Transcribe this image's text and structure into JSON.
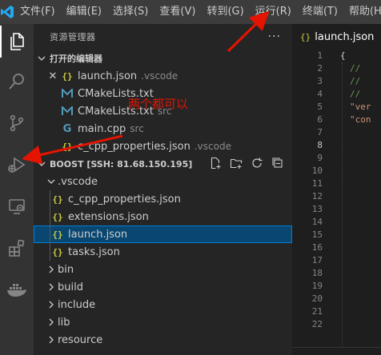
{
  "menu": [
    "文件(F)",
    "编辑(E)",
    "选择(S)",
    "查看(V)",
    "转到(G)",
    "运行(R)",
    "终端(T)",
    "帮助(H)"
  ],
  "sidebar": {
    "title": "资源管理器",
    "open_editors": {
      "header": "打开的编辑器",
      "items": [
        {
          "label": "launch.json",
          "desc": ".vscode",
          "icon": "json-icon"
        },
        {
          "label": "CMakeLists.txt",
          "desc": "",
          "icon": "cmake-icon"
        },
        {
          "label": "CMakeLists.txt",
          "desc": "src",
          "icon": "cmake-icon"
        },
        {
          "label": "main.cpp",
          "desc": "src",
          "icon": "cpp-icon"
        },
        {
          "label": "c_cpp_properties.json",
          "desc": ".vscode",
          "icon": "json-icon"
        }
      ]
    },
    "workspace": {
      "header": "BOOST [SSH: 81.68.150.195]",
      "vscode_folder": ".vscode",
      "vscode_files": [
        "c_cpp_properties.json",
        "extensions.json",
        "launch.json",
        "tasks.json"
      ],
      "folders": [
        "bin",
        "build",
        "include",
        "lib",
        "resource"
      ]
    }
  },
  "editor": {
    "tab_label": "launch.json",
    "line_numbers": [
      "1",
      "2",
      "3",
      "4",
      "5",
      "6",
      "7",
      "8",
      "9",
      "10",
      "11",
      "12",
      "13",
      "14",
      "15",
      "16",
      "17",
      "18",
      "19",
      "20",
      "21",
      "22"
    ],
    "code": {
      "l1": "{",
      "l2": "// ",
      "l3": "// ",
      "l4": "// ",
      "l5": "\"ver",
      "l6": "\"con"
    }
  },
  "annotation": "两个都可以",
  "colors": {
    "accent": "#007fd4",
    "annotation": "#e51400"
  }
}
